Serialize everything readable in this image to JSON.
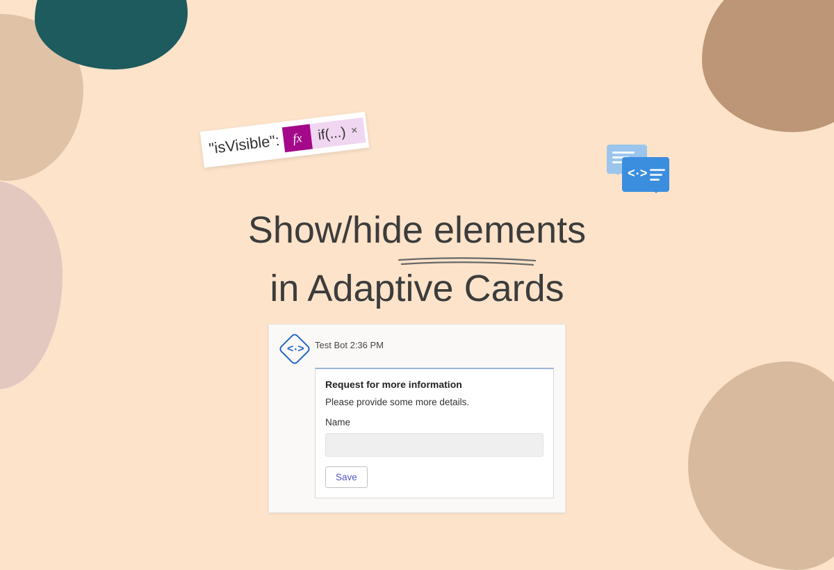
{
  "title_line1": "Show/hide elements",
  "title_line2": "in Adaptive Cards",
  "snippet": {
    "key": "\"isVisible\":",
    "fx": "fx",
    "expr": "if(...)",
    "close": "×"
  },
  "card": {
    "bot_name": "Test Bot",
    "time": "2:36 PM",
    "heading": "Request for more information",
    "body": "Please provide some more details.",
    "field_label": "Name",
    "save_label": "Save"
  }
}
